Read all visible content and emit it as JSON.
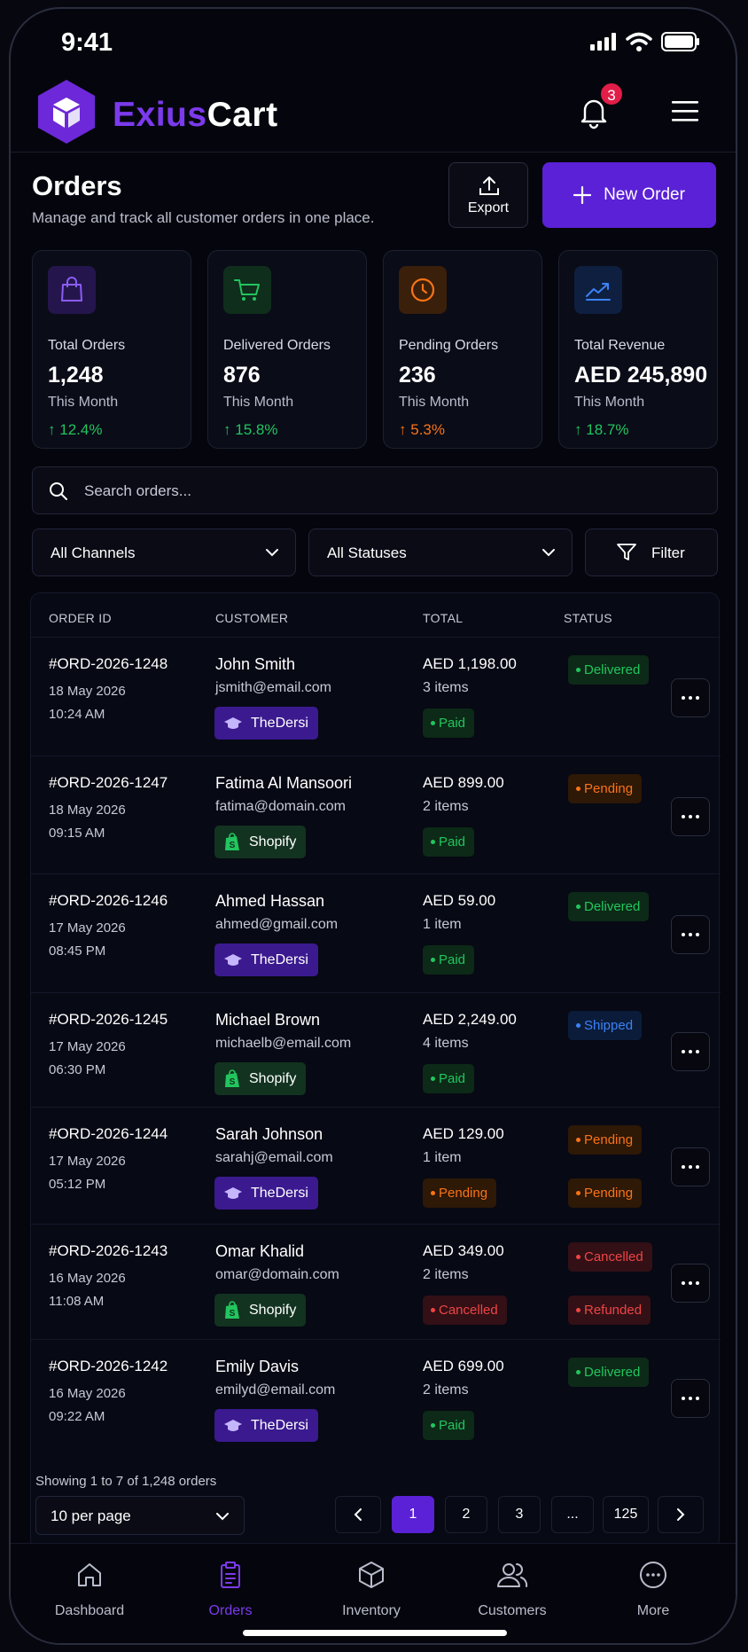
{
  "status_bar": {
    "time": "9:41"
  },
  "header": {
    "brand_part1": "Exius",
    "brand_part2": "Cart",
    "notification_count": "3"
  },
  "page": {
    "title": "Orders",
    "subtitle": "Manage and track all customer orders in one place.",
    "export_label": "Export",
    "new_order_label": "New Order"
  },
  "stats": [
    {
      "title": "Total Orders",
      "value": "1,248",
      "period": "This Month",
      "change": "12.4%",
      "icon": "shopping-bag-icon",
      "color": "#7c3aed",
      "trend": "up"
    },
    {
      "title": "Delivered Orders",
      "value": "876",
      "period": "This Month",
      "change": "15.8%",
      "icon": "cart-icon",
      "color": "#22c55e",
      "trend": "up"
    },
    {
      "title": "Pending Orders",
      "value": "236",
      "period": "This Month",
      "change": "5.3%",
      "icon": "clock-icon",
      "color": "#f97316",
      "trend": "up"
    },
    {
      "title": "Total Revenue",
      "value": "AED 245,890",
      "period": "This Month",
      "change": "18.7%",
      "icon": "trend-chart-icon",
      "color": "#3b82f6",
      "trend": "up"
    }
  ],
  "search": {
    "placeholder": "Search orders..."
  },
  "filters": {
    "channel": "All Channels",
    "status": "All Statuses",
    "filter_label": "Filter"
  },
  "table": {
    "headers": [
      "ORDER ID",
      "CUSTOMER",
      "TOTAL",
      "STATUS"
    ],
    "rows": [
      {
        "id": "#ORD-2026-1248",
        "date": "18 May 2026",
        "time": "10:24 AM",
        "customer": "John Smith",
        "email": "jsmith@email.com",
        "channel": "TheDersi",
        "total": "AED 1,198.00",
        "items": "3 items",
        "payment": "Paid",
        "status": "Delivered"
      },
      {
        "id": "#ORD-2026-1247",
        "date": "18 May 2026",
        "time": "09:15 AM",
        "customer": "Fatima Al Mansoori",
        "email": "fatima@domain.com",
        "channel": "Shopify",
        "total": "AED 899.00",
        "items": "2 items",
        "payment": "Paid",
        "status": "Pending"
      },
      {
        "id": "#ORD-2026-1246",
        "date": "17 May 2026",
        "time": "08:45 PM",
        "customer": "Ahmed Hassan",
        "email": "ahmed@gmail.com",
        "channel": "TheDersi",
        "total": "AED 59.00",
        "items": "1 item",
        "payment": "Paid",
        "status": "Delivered"
      },
      {
        "id": "#ORD-2026-1245",
        "date": "17 May 2026",
        "time": "06:30 PM",
        "customer": "Michael Brown",
        "email": "michaelb@email.com",
        "channel": "Shopify",
        "total": "AED 2,249.00",
        "items": "4 items",
        "payment": "Paid",
        "status": "Shipped"
      },
      {
        "id": "#ORD-2026-1244",
        "date": "17 May 2026",
        "time": "05:12 PM",
        "customer": "Sarah Johnson",
        "email": "sarahj@email.com",
        "channel": "TheDersi",
        "total": "AED 129.00",
        "items": "1 item",
        "payment": "Pending",
        "status": "Pending",
        "status2": "Pending"
      },
      {
        "id": "#ORD-2026-1243",
        "date": "16 May 2026",
        "time": "11:08 AM",
        "customer": "Omar Khalid",
        "email": "omar@domain.com",
        "channel": "Shopify",
        "total": "AED 349.00",
        "items": "2 items",
        "payment": "Cancelled",
        "status": "Cancelled",
        "status2": "Refunded"
      },
      {
        "id": "#ORD-2026-1242",
        "date": "16 May 2026",
        "time": "09:22 AM",
        "customer": "Emily Davis",
        "email": "emilyd@email.com",
        "channel": "TheDersi",
        "total": "AED 699.00",
        "items": "2 items",
        "payment": "Paid",
        "status": "Delivered"
      }
    ]
  },
  "pagination": {
    "showing": "Showing 1 to 7 of 1,248 orders",
    "per_page": "10 per page",
    "pages": [
      "1",
      "2",
      "3",
      "...",
      "125"
    ],
    "current": "1"
  },
  "bottom_nav": [
    {
      "label": "Dashboard",
      "icon": "home-icon"
    },
    {
      "label": "Orders",
      "icon": "clipboard-icon",
      "active": true
    },
    {
      "label": "Inventory",
      "icon": "box-icon"
    },
    {
      "label": "Customers",
      "icon": "users-icon"
    },
    {
      "label": "More",
      "icon": "more-icon"
    }
  ],
  "colors": {
    "accent": "#5b21d6",
    "brand_purple": "#7c3aed",
    "success": "#22c55e",
    "warning": "#f97316",
    "danger": "#ef4444",
    "info": "#3b82f6",
    "background": "#05060d"
  }
}
